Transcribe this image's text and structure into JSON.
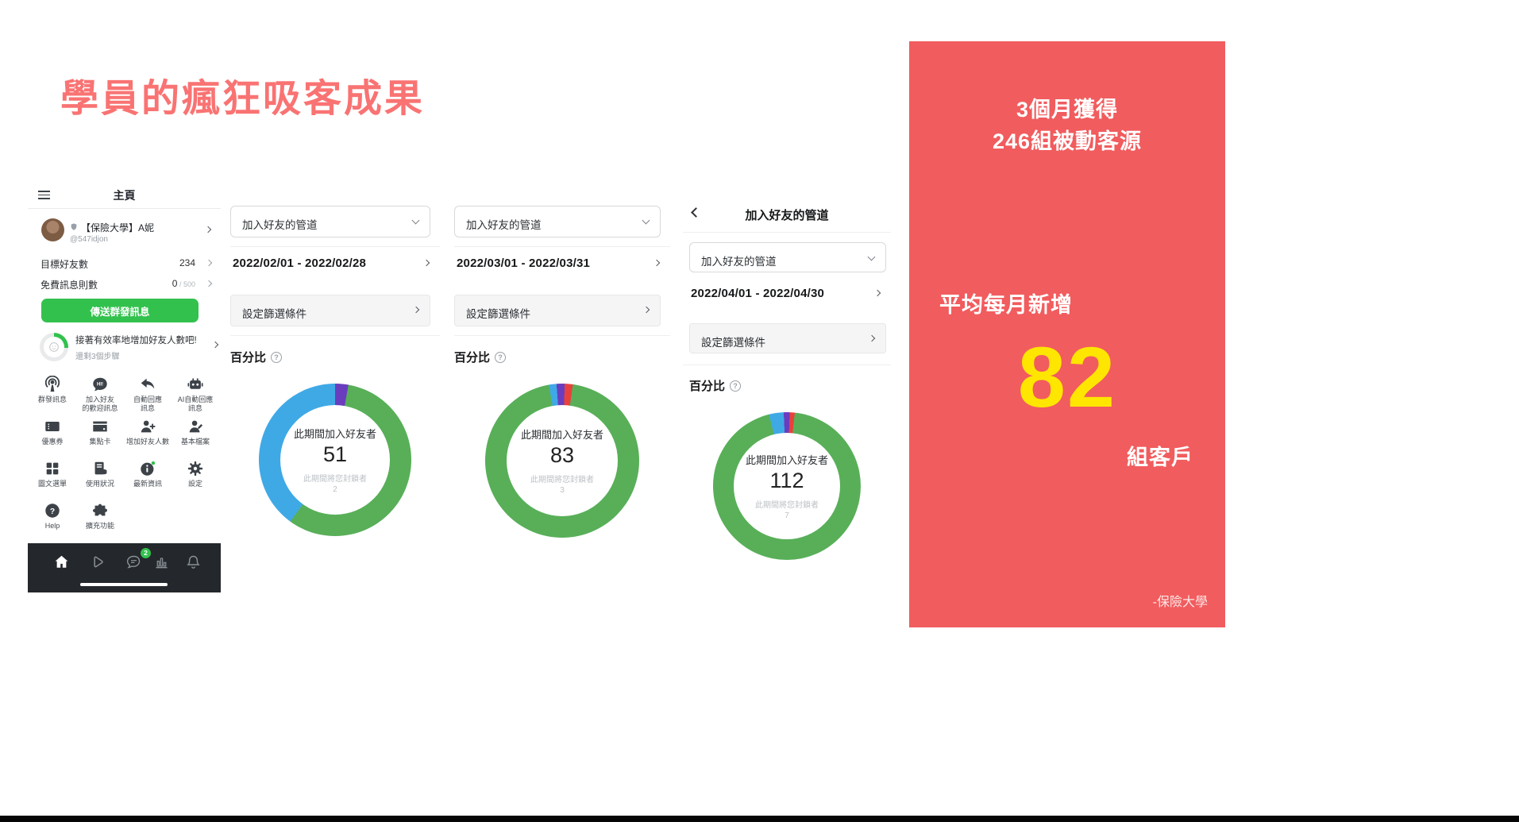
{
  "page": {
    "title": "學員的瘋狂吸客成果"
  },
  "phone": {
    "header_title": "主頁",
    "profile": {
      "name": "【保險大學】A妮",
      "id": "@547idjon"
    },
    "rows": [
      {
        "label": "目標好友數",
        "value": "234",
        "suffix": ""
      },
      {
        "label": "免費訊息則數",
        "value": "0",
        "suffix": " / 500"
      }
    ],
    "broadcast_button": "傳送群發訊息",
    "tip": {
      "line1": "接著有效率地增加好友人數吧!",
      "line2": "還剩3個步驟"
    },
    "menu": [
      {
        "label": "群發訊息",
        "icon": "broadcast-icon"
      },
      {
        "label": "加入好友\n的歡迎訊息",
        "icon": "welcome-message-icon"
      },
      {
        "label": "自動回應\n訊息",
        "icon": "auto-reply-icon"
      },
      {
        "label": "AI自動回應\n訊息",
        "icon": "ai-auto-reply-icon"
      },
      {
        "label": "優惠券",
        "icon": "coupon-icon"
      },
      {
        "label": "集點卡",
        "icon": "reward-card-icon"
      },
      {
        "label": "增加好友人數",
        "icon": "add-friends-icon"
      },
      {
        "label": "基本檔案",
        "icon": "basic-profile-icon"
      },
      {
        "label": "圖文選單",
        "icon": "rich-menu-icon"
      },
      {
        "label": "使用狀況",
        "icon": "usage-status-icon"
      },
      {
        "label": "最新資訊",
        "icon": "latest-news-icon"
      },
      {
        "label": "設定",
        "icon": "settings-icon"
      },
      {
        "label": "Help",
        "icon": "help-icon"
      },
      {
        "label": "擴充功能",
        "icon": "extensions-icon"
      }
    ],
    "nav_badge": "2"
  },
  "chart_data": [
    {
      "type": "donut",
      "channel_dropdown": "加入好友的管道",
      "period": "2022/02/01 - 2022/02/28",
      "filter_button": "設定篩選條件",
      "section_title": "百分比",
      "center_label": "此期間加入好友者",
      "joined": "51",
      "blocked_label": "此期間將您封鎖者",
      "blocked": "2",
      "rotate_deg": 0,
      "slices": [
        {
          "name": "purple",
          "color": "#6A3DBE",
          "pct": 2.8
        },
        {
          "name": "green",
          "color": "#58AF58",
          "pct": 57.2
        },
        {
          "name": "blue",
          "color": "#3FA9E6",
          "pct": 40.0
        }
      ]
    },
    {
      "type": "donut",
      "channel_dropdown": "加入好友的管道",
      "period": "2022/03/01 - 2022/03/31",
      "filter_button": "設定篩選條件",
      "section_title": "百分比",
      "center_label": "此期間加入好友者",
      "joined": "83",
      "blocked_label": "此期間將您封鎖者",
      "blocked": "3",
      "rotate_deg": -10,
      "slices": [
        {
          "name": "blue",
          "color": "#3FA9E6",
          "pct": 1.6
        },
        {
          "name": "purple",
          "color": "#6A3DBE",
          "pct": 1.7
        },
        {
          "name": "red",
          "color": "#E8413C",
          "pct": 1.7
        },
        {
          "name": "green",
          "color": "#58AF58",
          "pct": 95.0
        }
      ]
    },
    {
      "type": "donut",
      "header_title": "加入好友的管道",
      "channel_dropdown": "加入好友的管道",
      "period": "2022/04/01 - 2022/04/30",
      "filter_button": "設定篩選條件",
      "section_title": "百分比",
      "center_label": "此期間加入好友者",
      "joined": "112",
      "blocked_label": "此期間將您封鎖者",
      "blocked": "7",
      "rotate_deg": -14,
      "slices": [
        {
          "name": "blue",
          "color": "#3FA9E6",
          "pct": 3.2
        },
        {
          "name": "purple",
          "color": "#6A3DBE",
          "pct": 1.3
        },
        {
          "name": "red",
          "color": "#E8413C",
          "pct": 1.1
        },
        {
          "name": "green",
          "color": "#58AF58",
          "pct": 94.4
        }
      ]
    }
  ],
  "summary_panel": {
    "line1": "3個月獲得",
    "line2": "246組被動客源",
    "avg_label": "平均每月新增",
    "avg_value": "82",
    "avg_unit": "組客戶",
    "signature": "-保險大學",
    "bg_color": "#F15C5E",
    "accent_color": "#FFE600"
  }
}
